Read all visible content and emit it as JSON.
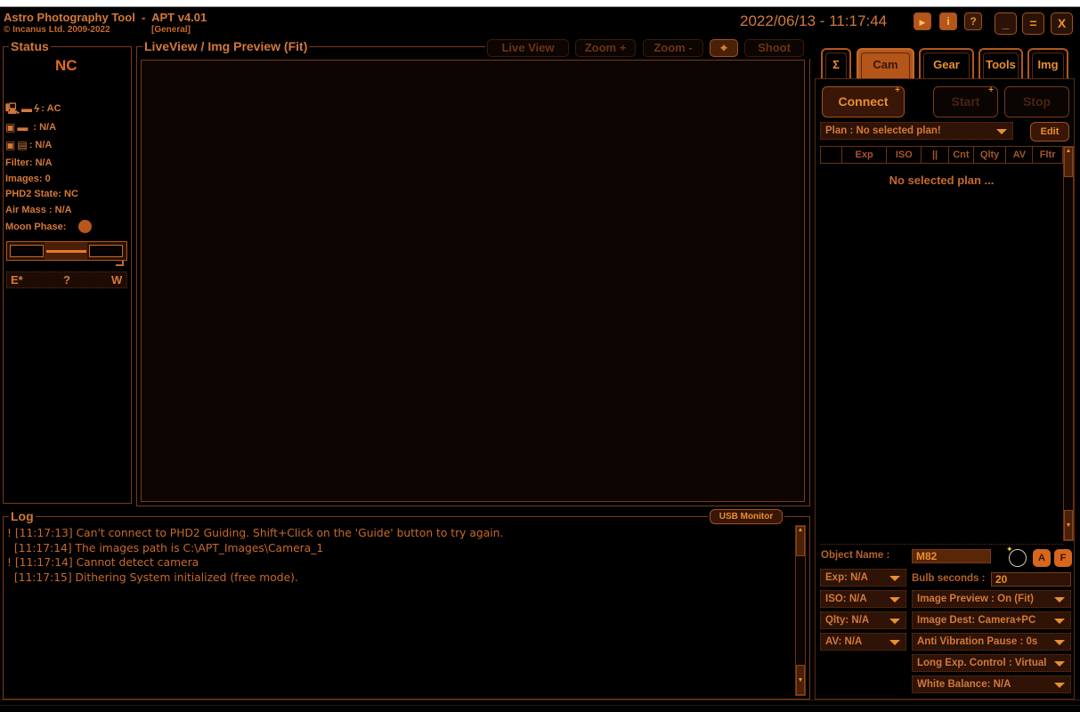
{
  "header": {
    "app_title": "Astro Photography Tool  -  APT v4.01",
    "copyright": "© Incanus Ltd. 2009-2022",
    "mode": "[General]",
    "datetime": "2022/06/13 - 11:17:44",
    "buttons": {
      "play": "▶",
      "info": "i",
      "help": "?",
      "minimize": "_",
      "maximize": "=",
      "close": "X"
    }
  },
  "status": {
    "label": "Status",
    "connection": "NC",
    "power": ": AC",
    "camera_battery": ": N/A",
    "camera_storage": ": N/A",
    "filter": "Filter: N/A",
    "images": "Images: 0",
    "phd2_state": "PHD2 State: NC",
    "air_mass": "Air Mass : N/A",
    "moon_phase": "Moon Phase:",
    "compass": {
      "east": "E*",
      "unknown": "?",
      "west": "W"
    }
  },
  "preview": {
    "label": "LiveView / Img Preview (Fit)",
    "buttons": {
      "live_view": "Live View",
      "zoom_in": "Zoom +",
      "zoom_out": "Zoom -",
      "crosshair": "⌖",
      "shoot": "Shoot"
    }
  },
  "tabs": [
    {
      "label": "Σ",
      "active": false
    },
    {
      "label": "Cam",
      "active": true
    },
    {
      "label": "Gear",
      "active": false
    },
    {
      "label": "Tools",
      "active": false
    },
    {
      "label": "Img",
      "active": false
    }
  ],
  "cam": {
    "connect": "Connect",
    "start": "Start",
    "stop": "Stop",
    "plus": "+",
    "plan_select": "Plan : No selected plan!",
    "edit": "Edit",
    "plan_columns": [
      "",
      "Exp",
      "ISO",
      "||",
      "Cnt",
      "Qlty",
      "AV",
      "Fltr"
    ],
    "no_plan": "No selected plan ...",
    "object_name_label": "Object Name :",
    "object_name_value": "M82",
    "af_a": "A",
    "af_f": "F",
    "bulb_label": "Bulb seconds :",
    "bulb_value": "20",
    "left_dropdowns": [
      "Exp: N/A",
      "ISO: N/A",
      "Qlty: N/A",
      "AV: N/A"
    ],
    "right_dropdowns": [
      "Image Preview : On (Fit)",
      "Image Dest: Camera+PC",
      "Anti Vibration Pause : 0s",
      "Long Exp. Control : Virtual",
      "White Balance: N/A"
    ]
  },
  "log": {
    "label": "Log",
    "usb_monitor": "USB Monitor",
    "lines": [
      "! [11:17:13] Can't connect to PHD2 Guiding. Shift+Click on the 'Guide' button to try again.",
      "  [11:17:14] The images path is C:\\APT_Images\\Camera_1",
      "! [11:17:14] Cannot detect camera",
      "  [11:17:15] Dithering System initialized (free mode)."
    ]
  }
}
